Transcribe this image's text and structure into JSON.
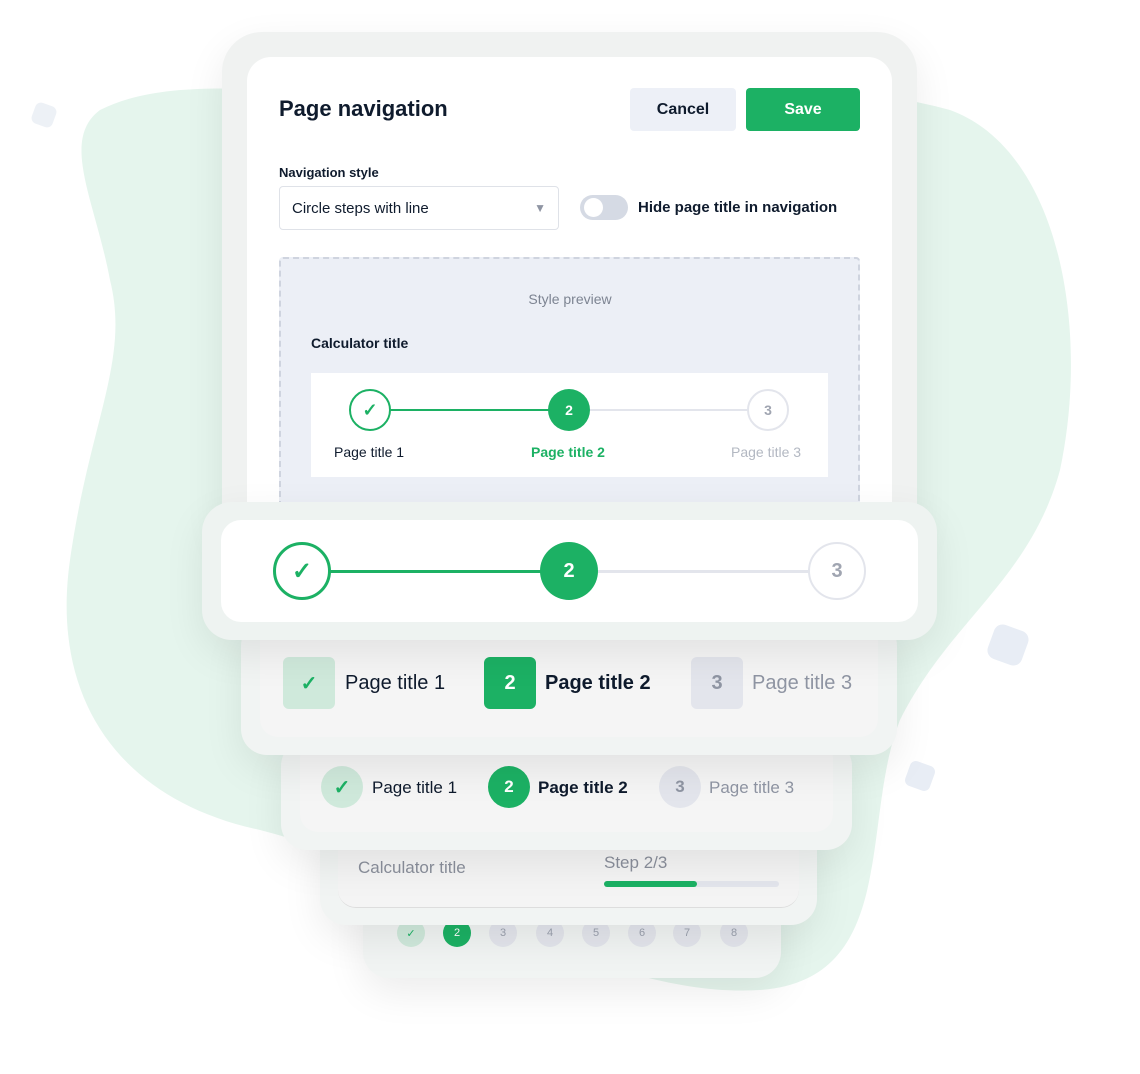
{
  "colors": {
    "accent": "#1cb164",
    "blob": "#e5f5ed",
    "preview_bg": "#eceff6"
  },
  "panel": {
    "title": "Page navigation",
    "cancel": "Cancel",
    "save": "Save",
    "nav_style_label": "Navigation style",
    "nav_style_value": "Circle steps with line",
    "toggle_label": "Hide page title in navigation",
    "toggle_on": false,
    "preview_label": "Style preview",
    "calc_title": "Calculator title",
    "steps": [
      {
        "num": "1",
        "label": "Page title 1",
        "state": "done"
      },
      {
        "num": "2",
        "label": "Page title 2",
        "state": "active"
      },
      {
        "num": "3",
        "label": "Page title 3",
        "state": "pending"
      }
    ]
  },
  "big_circles": {
    "active": "2",
    "pending": "3"
  },
  "square_steps": [
    {
      "num": "1",
      "label": "Page title 1"
    },
    {
      "num": "2",
      "label": "Page title 2"
    },
    {
      "num": "3",
      "label": "Page title 3"
    }
  ],
  "circle_steps": [
    {
      "num": "1",
      "label": "Page title 1"
    },
    {
      "num": "2",
      "label": "Page title 2"
    },
    {
      "num": "3",
      "label": "Page title 3"
    }
  ],
  "progress": {
    "title": "Calculator title",
    "step": "Step 2/3",
    "fraction": 0.53
  },
  "pagination": {
    "pages": [
      "1",
      "2",
      "3",
      "4",
      "5",
      "6",
      "7",
      "8"
    ],
    "active": "2"
  }
}
